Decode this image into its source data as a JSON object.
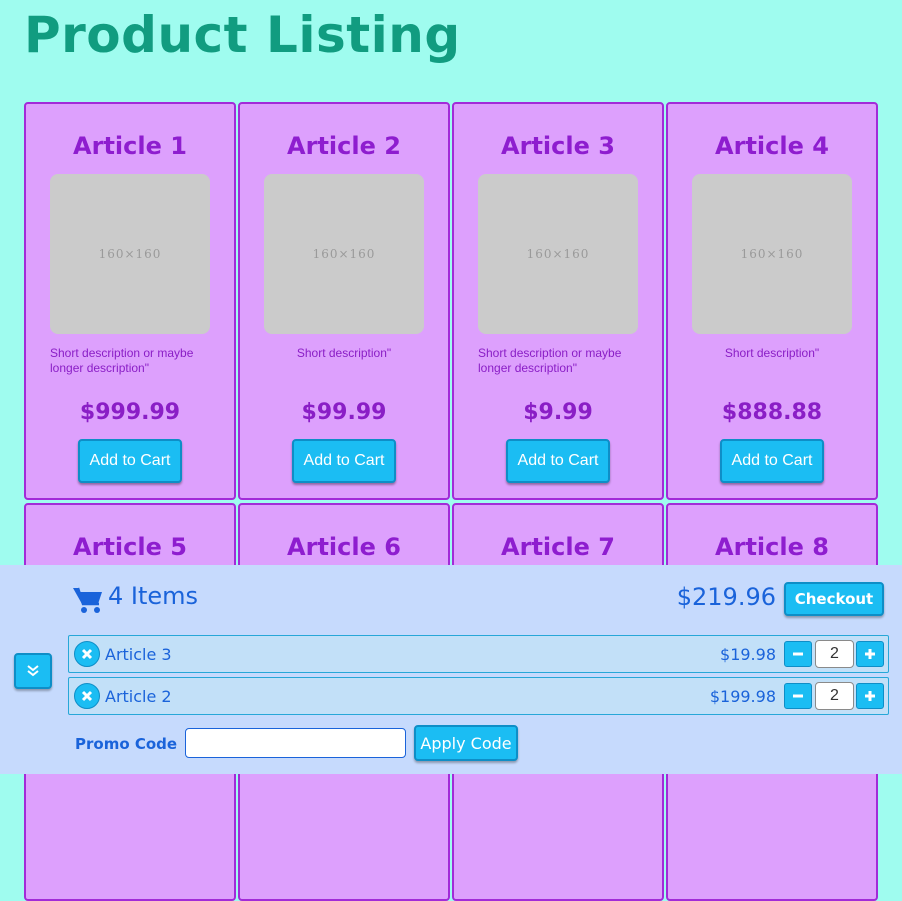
{
  "page": {
    "title": "Product Listing"
  },
  "colors": {
    "background": "#9ffcef",
    "title": "#119c80",
    "card_bg": "#dda0fd",
    "card_border": "#a22bd8",
    "card_text": "#8a1ec6",
    "button": "#1bbdf3",
    "cart_bg": "#c6dafd",
    "cart_text": "#1a63da"
  },
  "products": [
    {
      "name": "Article 1",
      "image_label": "160×160",
      "description": "Short description or maybe longer description\"",
      "price": "$999.99",
      "button": "Add to Cart"
    },
    {
      "name": "Article 2",
      "image_label": "160×160",
      "description": "Short description\"",
      "price": "$99.99",
      "button": "Add to Cart"
    },
    {
      "name": "Article 3",
      "image_label": "160×160",
      "description": "Short description or maybe longer description\"",
      "price": "$9.99",
      "button": "Add to Cart"
    },
    {
      "name": "Article 4",
      "image_label": "160×160",
      "description": "Short description\"",
      "price": "$888.88",
      "button": "Add to Cart"
    },
    {
      "name": "Article 5"
    },
    {
      "name": "Article 6"
    },
    {
      "name": "Article 7"
    },
    {
      "name": "Article 8"
    }
  ],
  "cart": {
    "icon": "shopping-cart-icon",
    "count_label": "4 Items",
    "total": "$219.96",
    "checkout_label": "Checkout",
    "collapse_icon": "double-chevron-down-icon",
    "items": [
      {
        "name": "Article 3",
        "price": "$19.98",
        "quantity": "2"
      },
      {
        "name": "Article 2",
        "price": "$199.98",
        "quantity": "2"
      }
    ],
    "promo_label": "Promo Code",
    "promo_value": "",
    "apply_label": "Apply Code"
  }
}
